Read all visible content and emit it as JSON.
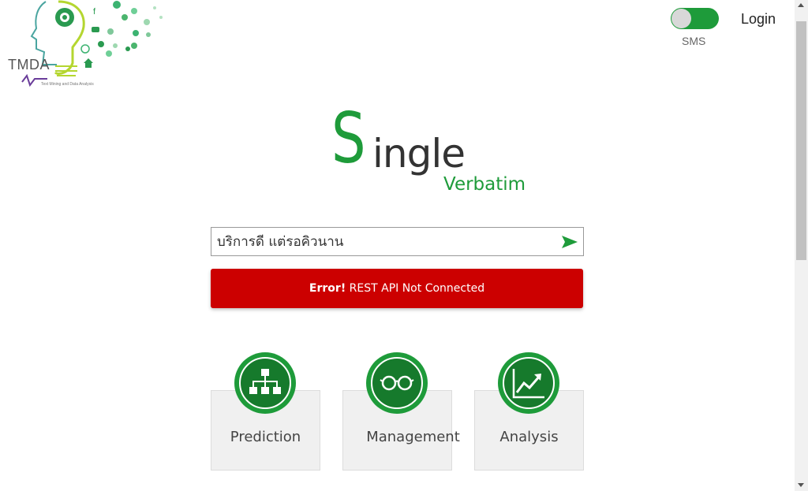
{
  "logo": {
    "brand": "TMDA",
    "tagline": "Text Mining and Data Analysis"
  },
  "header": {
    "toggle_label": "SMS",
    "login_label": "Login"
  },
  "title": {
    "first_letter": "S",
    "rest": "ingle",
    "subtitle": "Verbatim"
  },
  "search": {
    "value": "บริการดี แต่รอคิวนาน",
    "send_icon": "send-arrow-icon"
  },
  "error": {
    "prefix": "Error!",
    "message": " REST API Not Connected"
  },
  "cards": [
    {
      "label": "Prediction",
      "icon": "sitemap-icon"
    },
    {
      "label": "Management",
      "icon": "glasses-icon"
    },
    {
      "label": "Analysis",
      "icon": "trend-chart-icon"
    }
  ],
  "colors": {
    "brand_green": "#1e9b3a",
    "error_red": "#cc0000"
  }
}
